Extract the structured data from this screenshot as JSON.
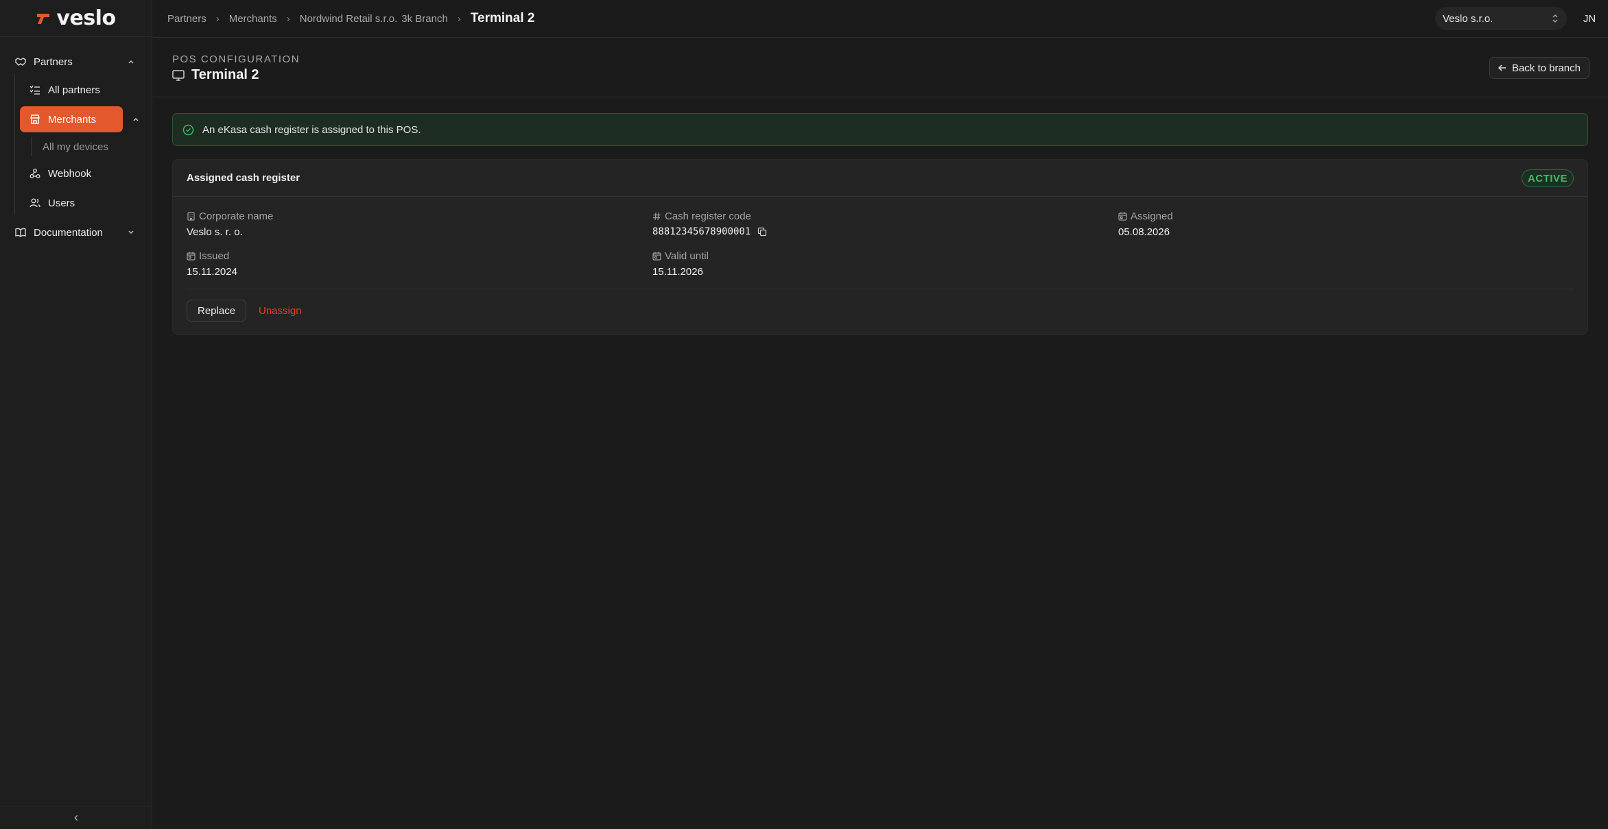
{
  "brand": {
    "name": "veslo",
    "accent": "#e3582c"
  },
  "sidebar": {
    "items": [
      {
        "label": "Partners",
        "icon": "handshake-icon",
        "expanded": true
      },
      {
        "label": "All partners",
        "icon": "list-check-icon"
      },
      {
        "label": "Merchants",
        "icon": "store-icon",
        "active": true,
        "expanded": true
      },
      {
        "label": "All my devices"
      },
      {
        "label": "Webhook",
        "icon": "webhook-icon"
      },
      {
        "label": "Users",
        "icon": "users-icon"
      },
      {
        "label": "Documentation",
        "icon": "book-icon",
        "expanded": false
      }
    ],
    "collapse_glyph": "‹"
  },
  "topbar": {
    "breadcrumbs": [
      "Partners",
      "Merchants",
      "Nordwind Retail s.r.o.",
      "3k Branch"
    ],
    "current": "Terminal 2",
    "org_select": "Veslo s.r.o.",
    "avatar_initials": "JN"
  },
  "header": {
    "eyebrow": "POS CONFIGURATION",
    "title": "Terminal 2",
    "back_label": "Back to branch"
  },
  "alert": {
    "text": "An eKasa cash register is assigned to this POS.",
    "color": "#43b865"
  },
  "card": {
    "title": "Assigned cash register",
    "status": "ACTIVE",
    "fields": {
      "corporate_name": {
        "label": "Corporate name",
        "value": "Veslo s. r. o."
      },
      "cash_register_code": {
        "label": "Cash register code",
        "value": "88812345678900001"
      },
      "assigned": {
        "label": "Assigned",
        "value": "05.08.2026"
      },
      "issued": {
        "label": "Issued",
        "value": "15.11.2024"
      },
      "valid_until": {
        "label": "Valid until",
        "value": "15.11.2026"
      }
    },
    "actions": {
      "replace": "Replace",
      "unassign": "Unassign"
    },
    "danger_color": "#e5412f"
  }
}
